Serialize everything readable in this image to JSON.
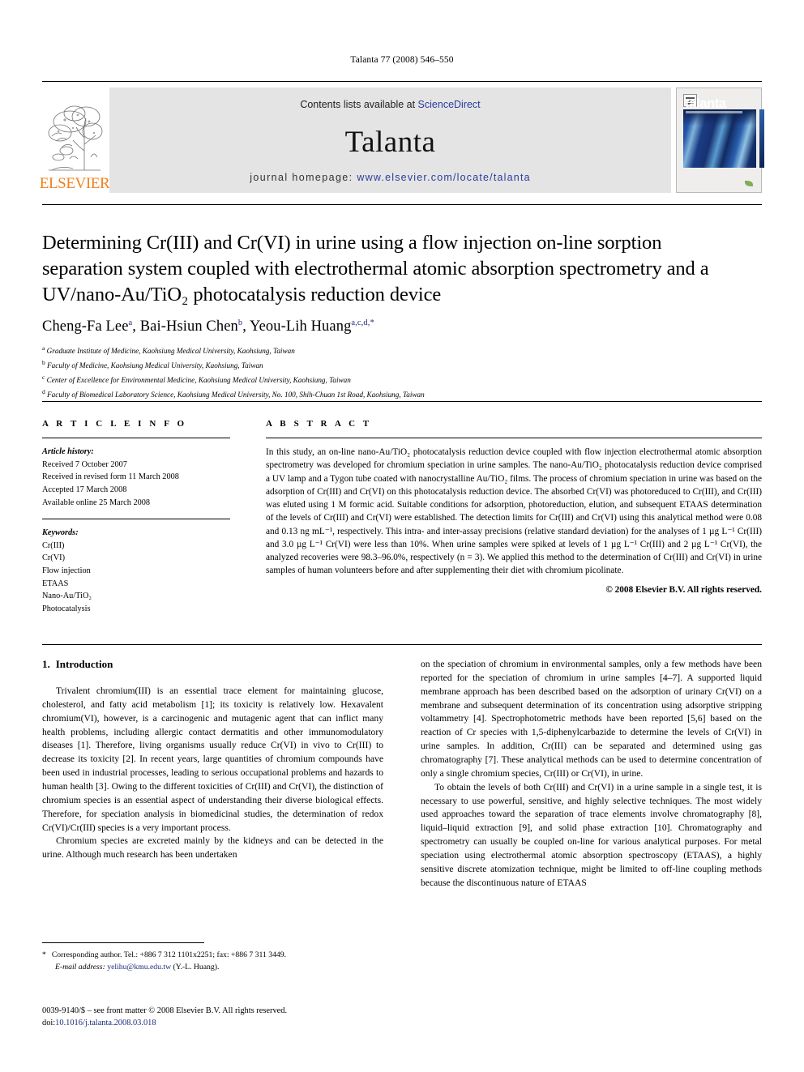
{
  "running_head": "Talanta 77 (2008) 546–550",
  "banner": {
    "publisher_logo_text": "ELSEVIER",
    "logo_icon": "elsevier-tree-icon",
    "contents_prefix": "Contents lists available at ",
    "contents_link": "ScienceDirect",
    "journal_title": "Talanta",
    "homepage_prefix": "journal homepage: ",
    "homepage_url": "www.elsevier.com/locate/talanta",
    "cover": {
      "word": "talanta",
      "sd_mark": "sciencedirect-mark-icon",
      "footer_mark": "elsevier-leaf-icon"
    }
  },
  "article": {
    "title": "Determining Cr(III) and Cr(VI) in urine using a flow injection on-line sorption separation system coupled with electrothermal atomic absorption spectrometry and a UV/nano-Au/TiO₂ photocatalysis reduction device",
    "authors": [
      {
        "name": "Cheng-Fa Lee",
        "marks": "a"
      },
      {
        "name": "Bai-Hsiun Chen",
        "marks": "b"
      },
      {
        "name": "Yeou-Lih Huang",
        "marks": "a,c,d,*"
      }
    ],
    "affiliations": [
      {
        "mark": "a",
        "text": "Graduate Institute of Medicine, Kaohsiung Medical University, Kaohsiung, Taiwan"
      },
      {
        "mark": "b",
        "text": "Faculty of Medicine, Kaohsiung Medical University, Kaohsiung, Taiwan"
      },
      {
        "mark": "c",
        "text": "Center of Excellence for Environmental Medicine, Kaohsiung Medical University, Kaohsiung, Taiwan"
      },
      {
        "mark": "d",
        "text": "Faculty of Biomedical Laboratory Science, Kaohsiung Medical University, No. 100, Shih-Chuan 1st Road, Kaohsiung, Taiwan"
      }
    ]
  },
  "info": {
    "heading": "A R T I C L E    I N F O",
    "history_label": "Article history:",
    "history": [
      "Received 7 October 2007",
      "Received in revised form 11 March 2008",
      "Accepted 17 March 2008",
      "Available online 25 March 2008"
    ],
    "keywords_label": "Keywords:",
    "keywords": [
      "Cr(III)",
      "Cr(VI)",
      "Flow injection",
      "ETAAS",
      "Nano-Au/TiO₂",
      "Photocatalysis"
    ]
  },
  "abstract": {
    "heading": "A B S T R A C T",
    "text": "In this study, an on-line nano-Au/TiO₂ photocatalysis reduction device coupled with flow injection electrothermal atomic absorption spectrometry was developed for chromium speciation in urine samples. The nano-Au/TiO₂ photocatalysis reduction device comprised a UV lamp and a Tygon tube coated with nanocrystalline Au/TiO₂ films. The process of chromium speciation in urine was based on the adsorption of Cr(III) and Cr(VI) on this photocatalysis reduction device. The absorbed Cr(VI) was photoreduced to Cr(III), and Cr(III) was eluted using 1 M formic acid. Suitable conditions for adsorption, photoreduction, elution, and subsequent ETAAS determination of the levels of Cr(III) and Cr(VI) were established. The detection limits for Cr(III) and Cr(VI) using this analytical method were 0.08 and 0.13 ng mL⁻¹, respectively. This intra- and inter-assay precisions (relative standard deviation) for the analyses of 1 µg L⁻¹ Cr(III) and 3.0 µg L⁻¹ Cr(VI) were less than 10%. When urine samples were spiked at levels of 1 µg L⁻¹ Cr(III) and 2 µg L⁻¹ Cr(VI), the analyzed recoveries were 98.3–96.0%, respectively (n = 3). We applied this method to the determination of Cr(III) and Cr(VI) in urine samples of human volunteers before and after supplementing their diet with chromium picolinate.",
    "copyright": "© 2008 Elsevier B.V. All rights reserved."
  },
  "body": {
    "section_number": "1.",
    "section_title": "Introduction",
    "left_paragraphs": [
      "Trivalent chromium(III) is an essential trace element for maintaining glucose, cholesterol, and fatty acid metabolism [1]; its toxicity is relatively low. Hexavalent chromium(VI), however, is a carcinogenic and mutagenic agent that can inflict many health problems, including allergic contact dermatitis and other immunomodulatory diseases [1]. Therefore, living organisms usually reduce Cr(VI) in vivo to Cr(III) to decrease its toxicity [2]. In recent years, large quantities of chromium compounds have been used in industrial processes, leading to serious occupational problems and hazards to human health [3]. Owing to the different toxicities of Cr(III) and Cr(VI), the distinction of chromium species is an essential aspect of understanding their diverse biological effects. Therefore, for speciation analysis in biomedicinal studies, the determination of redox Cr(VI)/Cr(III) species is a very important process.",
      "Chromium species are excreted mainly by the kidneys and can be detected in the urine. Although much research has been undertaken"
    ],
    "right_paragraphs": [
      "on the speciation of chromium in environmental samples, only a few methods have been reported for the speciation of chromium in urine samples [4–7]. A supported liquid membrane approach has been described based on the adsorption of urinary Cr(VI) on a membrane and subsequent determination of its concentration using adsorptive stripping voltammetry [4]. Spectrophotometric methods have been reported [5,6] based on the reaction of Cr species with 1,5-diphenylcarbazide to determine the levels of Cr(VI) in urine samples. In addition, Cr(III) can be separated and determined using gas chromatography [7]. These analytical methods can be used to determine concentration of only a single chromium species, Cr(III) or Cr(VI), in urine.",
      "To obtain the levels of both Cr(III) and Cr(VI) in a urine sample in a single test, it is necessary to use powerful, sensitive, and highly selective techniques. The most widely used approaches toward the separation of trace elements involve chromatography [8], liquid–liquid extraction [9], and solid phase extraction [10]. Chromatography and spectrometry can usually be coupled on-line for various analytical purposes. For metal speciation using electrothermal atomic absorption spectroscopy (ETAAS), a highly sensitive discrete atomization technique, might be limited to off-line coupling methods because the discontinuous nature of ETAAS"
    ]
  },
  "footnotes": {
    "star": "*",
    "corresponding": "Corresponding author. Tel.: +886 7 312 1101x2251; fax: +886 7 311 3449.",
    "email_label": "E-mail address:",
    "email": "yelihu@kmu.edu.tw",
    "email_suffix": "(Y.-L. Huang).",
    "issn_line": "0039-9140/$ – see front matter © 2008 Elsevier B.V. All rights reserved.",
    "doi_label": "doi:",
    "doi": "10.1016/j.talanta.2008.03.018"
  }
}
